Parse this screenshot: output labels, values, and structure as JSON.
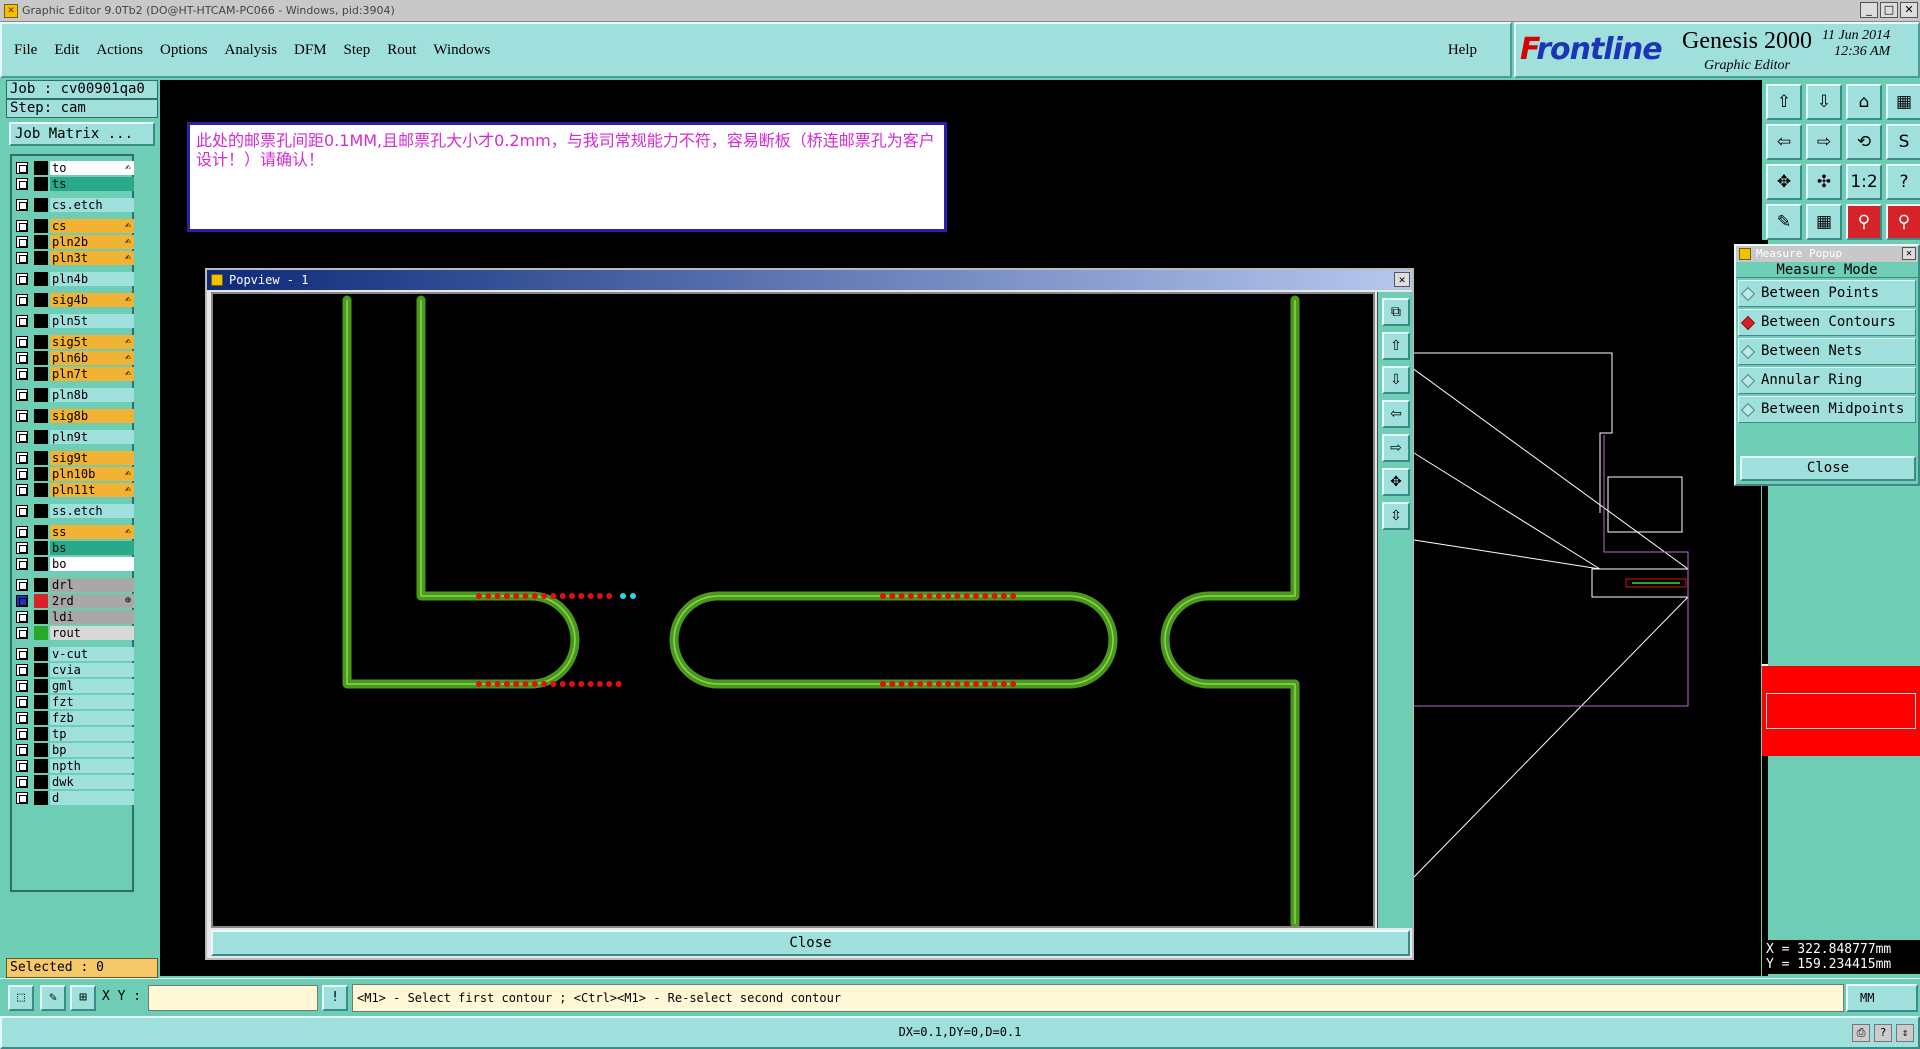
{
  "window": {
    "title": "Graphic Editor 9.0Tb2 (DO@HT-HTCAM-PC066 - Windows, pid:3904)",
    "min": "_",
    "max": "□",
    "close": "✕"
  },
  "menu": {
    "items": [
      "File",
      "Edit",
      "Actions",
      "Options",
      "Analysis",
      "DFM",
      "Step",
      "Rout",
      "Windows"
    ],
    "help": "Help"
  },
  "brand": {
    "logo_prefix": "F",
    "logo_rest": "rontline",
    "product": "Genesis 2000",
    "subtitle": "Graphic Editor",
    "date": "11 Jun 2014",
    "time": "12:36 AM"
  },
  "job": {
    "job_label": "Job : cv00901qa0",
    "step_label": "Step: cam",
    "matrix_button": "Job Matrix ..."
  },
  "layers": [
    {
      "name": "to",
      "color": "#ffffff",
      "swatch": "#000000",
      "mark": "✍"
    },
    {
      "name": "ts",
      "color": "#2aa88a",
      "swatch": "#000000",
      "mark": ""
    },
    {
      "gap": true
    },
    {
      "name": "cs.etch",
      "color": "#9fdfdc",
      "swatch": "#000000",
      "mark": ""
    },
    {
      "gap": true
    },
    {
      "name": "cs",
      "color": "#f2b233",
      "swatch": "#000000",
      "mark": "✍"
    },
    {
      "name": "pln2b",
      "color": "#f2b233",
      "swatch": "#000000",
      "mark": "✍"
    },
    {
      "name": "pln3t",
      "color": "#f2b233",
      "swatch": "#000000",
      "mark": "✍"
    },
    {
      "gap": true
    },
    {
      "name": "pln4b",
      "color": "#9fdfdc",
      "swatch": "#000000",
      "mark": ""
    },
    {
      "gap": true
    },
    {
      "name": "sig4b",
      "color": "#f2b233",
      "swatch": "#000000",
      "mark": "✍"
    },
    {
      "gap": true
    },
    {
      "name": "pln5t",
      "color": "#9fdfdc",
      "swatch": "#000000",
      "mark": ""
    },
    {
      "gap": true
    },
    {
      "name": "sig5t",
      "color": "#f2b233",
      "swatch": "#000000",
      "mark": "✍"
    },
    {
      "name": "pln6b",
      "color": "#f2b233",
      "swatch": "#000000",
      "mark": "✍"
    },
    {
      "name": "pln7t",
      "color": "#f2b233",
      "swatch": "#000000",
      "mark": "✍"
    },
    {
      "gap": true
    },
    {
      "name": "pln8b",
      "color": "#9fdfdc",
      "swatch": "#000000",
      "mark": ""
    },
    {
      "gap": true
    },
    {
      "name": "sig8b",
      "color": "#f2b233",
      "swatch": "#000000",
      "mark": ""
    },
    {
      "gap": true
    },
    {
      "name": "pln9t",
      "color": "#9fdfdc",
      "swatch": "#000000",
      "mark": ""
    },
    {
      "gap": true
    },
    {
      "name": "sig9t",
      "color": "#f2b233",
      "swatch": "#000000",
      "mark": ""
    },
    {
      "name": "pln10b",
      "color": "#f2b233",
      "swatch": "#000000",
      "mark": "✍"
    },
    {
      "name": "pln11t",
      "color": "#f2b233",
      "swatch": "#000000",
      "mark": "✍"
    },
    {
      "gap": true
    },
    {
      "name": "ss.etch",
      "color": "#9fdfdc",
      "swatch": "#000000",
      "mark": ""
    },
    {
      "gap": true
    },
    {
      "name": "ss",
      "color": "#f2b233",
      "swatch": "#000000",
      "mark": "✍"
    },
    {
      "name": "bs",
      "color": "#2aa88a",
      "swatch": "#000000",
      "mark": ""
    },
    {
      "name": "bo",
      "color": "#ffffff",
      "swatch": "#000000",
      "mark": ""
    },
    {
      "gap": true
    },
    {
      "name": "drl",
      "color": "#a8a8a8",
      "swatch": "#000000",
      "mark": ""
    },
    {
      "name": "2rd",
      "color": "#a8a8a8",
      "swatch": "#d6232a",
      "mark": "⊕",
      "checked": true
    },
    {
      "name": "ldi",
      "color": "#a8a8a8",
      "swatch": "#000000",
      "mark": ""
    },
    {
      "name": "rout",
      "color": "#d8d8d8",
      "swatch": "#2aa82a",
      "mark": ""
    },
    {
      "gap": true
    },
    {
      "name": "v-cut",
      "color": "#9fdfdc",
      "swatch": "#000000",
      "mark": ""
    },
    {
      "name": "cvia",
      "color": "#9fdfdc",
      "swatch": "#000000",
      "mark": ""
    },
    {
      "name": "gml",
      "color": "#9fdfdc",
      "swatch": "#000000",
      "mark": ""
    },
    {
      "name": "fzt",
      "color": "#9fdfdc",
      "swatch": "#000000",
      "mark": ""
    },
    {
      "name": "fzb",
      "color": "#9fdfdc",
      "swatch": "#000000",
      "mark": ""
    },
    {
      "name": "tp",
      "color": "#9fdfdc",
      "swatch": "#000000",
      "mark": ""
    },
    {
      "name": "bp",
      "color": "#9fdfdc",
      "swatch": "#000000",
      "mark": ""
    },
    {
      "name": "npth",
      "color": "#9fdfdc",
      "swatch": "#000000",
      "mark": ""
    },
    {
      "name": "dwk",
      "color": "#9fdfdc",
      "swatch": "#000000",
      "mark": ""
    },
    {
      "name": "d",
      "color": "#9fdfdc",
      "swatch": "#000000",
      "mark": ""
    }
  ],
  "selected": "Selected : 0",
  "note": {
    "text": "此处的邮票孔间距0.1MM,且邮票孔大小才0.2mm，与我司常规能力不符，容易断板（桥连邮票孔为客户设计！）请确认！"
  },
  "popview": {
    "title": "Popview - 1",
    "close_label": "Close",
    "tools": [
      "⧉",
      "⇧",
      "⇩",
      "⇦",
      "⇨",
      "✥",
      "⇳"
    ]
  },
  "toolgrid": {
    "icons": [
      "⇧",
      "⇩",
      "⌂",
      "▦",
      "⇦",
      "⇨",
      "⟲",
      "S",
      "✥",
      "✣",
      "1:2",
      "?",
      "✎",
      "▦",
      "⚲",
      "⚲"
    ]
  },
  "measure": {
    "title": "Measure Popup",
    "heading": "Measure Mode",
    "options": [
      "Between Points",
      "Between Contours",
      "Between Nets",
      "Annular Ring",
      "Between Midpoints"
    ],
    "selected_index": 1,
    "close_label": "Close"
  },
  "coords": {
    "x": "X = 322.848777mm",
    "y": "Y = 159.234415mm"
  },
  "command": {
    "xy_label": "X Y :",
    "xy_value": "",
    "info_icon": "!",
    "prompt": "<M1> - Select first contour ; <Ctrl><M1> - Re-select second contour",
    "units": "MM"
  },
  "status": {
    "text": "DX=0.1,DY=0,D=0.1"
  },
  "colors": {
    "panel": "#6ecdb5",
    "button": "#9fdfdc",
    "trace_green": "#4a9a1a",
    "pad_red": "#e01010",
    "highlight_red": "#ff0000"
  }
}
